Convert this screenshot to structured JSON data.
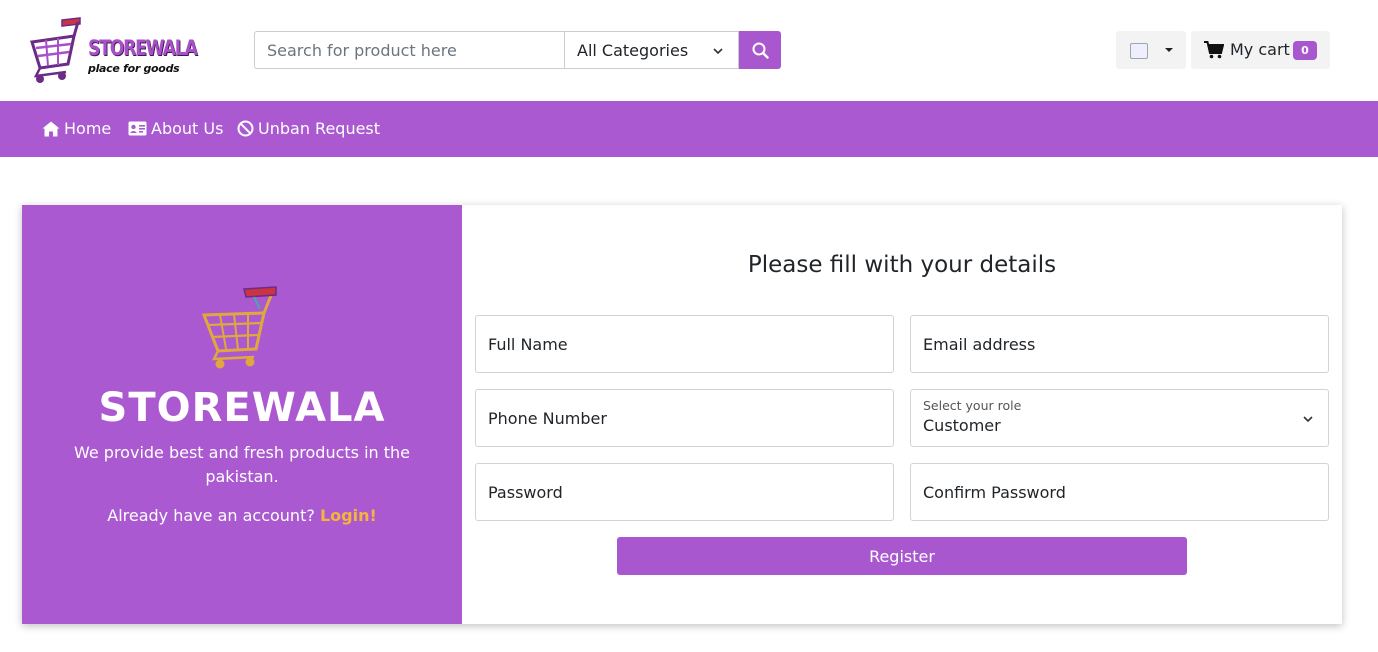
{
  "header": {
    "logo_text": "STOREWALA",
    "logo_subtitle": "place for goods",
    "search_placeholder": "Search for product here",
    "category_selected": "All Categories",
    "cart_label": "My cart",
    "cart_count": "0"
  },
  "nav": {
    "items": [
      {
        "label": "Home",
        "icon": "home-icon"
      },
      {
        "label": "About Us",
        "icon": "id-card-icon"
      },
      {
        "label": "Unban Request",
        "icon": "ban-icon"
      }
    ]
  },
  "left": {
    "brand": "STOREWALA",
    "tagline": "We provide best and fresh products in the pakistan.",
    "already_text": "Already have an account?",
    "login_label": "Login!"
  },
  "form": {
    "title": "Please fill with your details",
    "full_name_placeholder": "Full Name",
    "email_placeholder": "Email address",
    "phone_placeholder": "Phone Number",
    "role_label": "Select your role",
    "role_value": "Customer",
    "password_placeholder": "Password",
    "confirm_password_placeholder": "Confirm Password",
    "register_label": "Register"
  },
  "colors": {
    "accent": "#aa59d1",
    "login_link": "#f5b43a"
  }
}
